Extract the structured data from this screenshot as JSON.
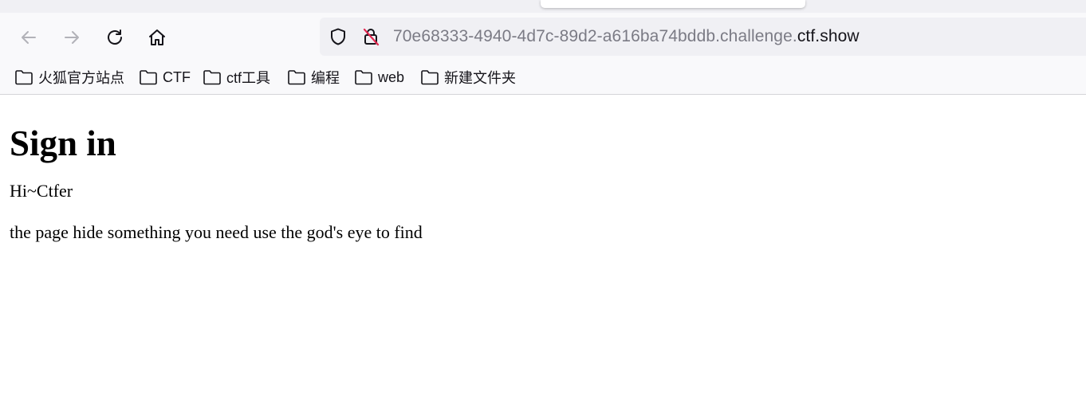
{
  "browser": {
    "url_prefix": "70e68333-4940-4d7c-89d2-a616ba74bddb.challenge.",
    "url_domain": "ctf.show",
    "nav_icons": [
      "back-arrow-icon",
      "forward-arrow-icon",
      "reload-icon",
      "home-icon"
    ],
    "url_icons": [
      "shield-icon",
      "insecure-lock-icon"
    ]
  },
  "bookmarks": [
    {
      "label": "火狐官方站点",
      "icon": "folder-icon"
    },
    {
      "label": "CTF",
      "icon": "folder-icon"
    },
    {
      "label": "ctf工具",
      "icon": "folder-icon"
    },
    {
      "label": "编程",
      "icon": "folder-icon"
    },
    {
      "label": "web",
      "icon": "folder-icon"
    },
    {
      "label": "新建文件夹",
      "icon": "folder-icon"
    }
  ],
  "page": {
    "heading": "Sign in",
    "greeting": "Hi~Ctfer",
    "hint": "the page hide something you need use the god's eye to find"
  },
  "colors": {
    "chrome_bg": "#f9f9fb",
    "urlbar_bg": "#f0f0f4",
    "url_muted": "#7b7b85",
    "text": "#15141a",
    "insecure_accent": "#e22850"
  }
}
